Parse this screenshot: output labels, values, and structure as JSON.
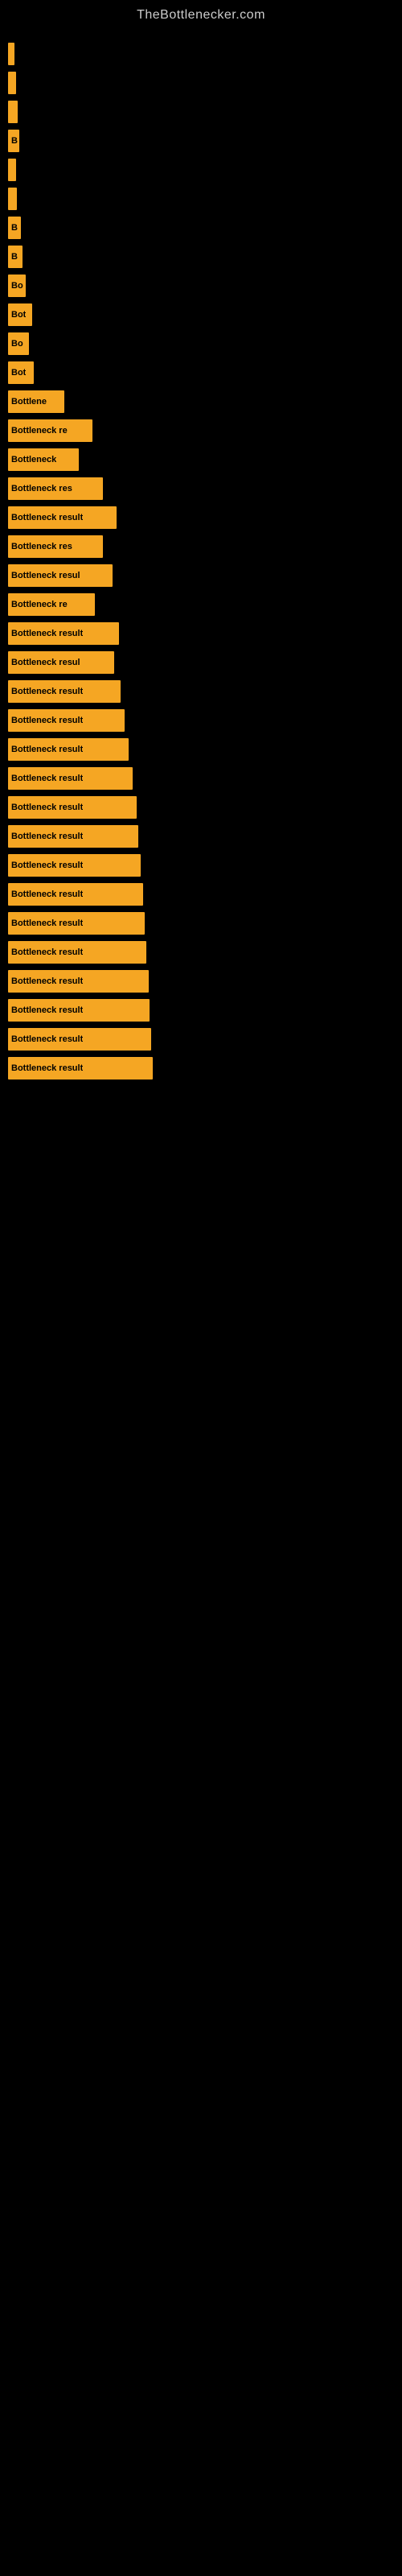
{
  "site": {
    "title": "TheBottlenecker.com"
  },
  "bars": [
    {
      "label": "",
      "width": 8
    },
    {
      "label": "",
      "width": 10
    },
    {
      "label": "",
      "width": 12
    },
    {
      "label": "B",
      "width": 14
    },
    {
      "label": "",
      "width": 10
    },
    {
      "label": "",
      "width": 11
    },
    {
      "label": "B",
      "width": 16
    },
    {
      "label": "B",
      "width": 18
    },
    {
      "label": "Bo",
      "width": 22
    },
    {
      "label": "Bot",
      "width": 30
    },
    {
      "label": "Bo",
      "width": 26
    },
    {
      "label": "Bot",
      "width": 32
    },
    {
      "label": "Bottlene",
      "width": 70
    },
    {
      "label": "Bottleneck re",
      "width": 105
    },
    {
      "label": "Bottleneck",
      "width": 88
    },
    {
      "label": "Bottleneck res",
      "width": 118
    },
    {
      "label": "Bottleneck result",
      "width": 135
    },
    {
      "label": "Bottleneck res",
      "width": 118
    },
    {
      "label": "Bottleneck resul",
      "width": 130
    },
    {
      "label": "Bottleneck re",
      "width": 108
    },
    {
      "label": "Bottleneck result",
      "width": 138
    },
    {
      "label": "Bottleneck resul",
      "width": 132
    },
    {
      "label": "Bottleneck result",
      "width": 140
    },
    {
      "label": "Bottleneck result",
      "width": 145
    },
    {
      "label": "Bottleneck result",
      "width": 150
    },
    {
      "label": "Bottleneck result",
      "width": 155
    },
    {
      "label": "Bottleneck result",
      "width": 160
    },
    {
      "label": "Bottleneck result",
      "width": 162
    },
    {
      "label": "Bottleneck result",
      "width": 165
    },
    {
      "label": "Bottleneck result",
      "width": 168
    },
    {
      "label": "Bottleneck result",
      "width": 170
    },
    {
      "label": "Bottleneck result",
      "width": 172
    },
    {
      "label": "Bottleneck result",
      "width": 175
    },
    {
      "label": "Bottleneck result",
      "width": 176
    },
    {
      "label": "Bottleneck result",
      "width": 178
    },
    {
      "label": "Bottleneck result",
      "width": 180
    }
  ]
}
